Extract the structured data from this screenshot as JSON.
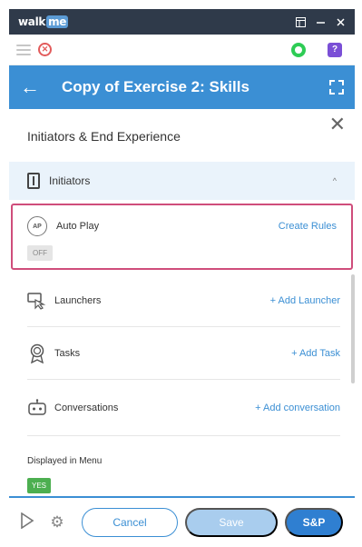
{
  "app": {
    "logo": {
      "walk": "walk",
      "me": "me"
    },
    "titlebar_icons": [
      "window-icon",
      "minimize-icon",
      "close-icon"
    ]
  },
  "header": {
    "title": "Copy of Exercise 2: Skills"
  },
  "panel": {
    "section_title": "Initiators & End Experience",
    "initiators": {
      "label": "Initiators",
      "chevron": "^"
    },
    "auto_play": {
      "icon_text": "AP",
      "label": "Auto Play",
      "link": "Create Rules",
      "state": "OFF"
    },
    "rows": [
      {
        "name": "launchers",
        "label": "Launchers",
        "link": "+ Add Launcher",
        "icon": "launcher-icon"
      },
      {
        "name": "tasks",
        "label": "Tasks",
        "link": "+ Add Task",
        "icon": "task-badge-icon"
      },
      {
        "name": "conversations",
        "label": "Conversations",
        "link": "+ Add conversation",
        "icon": "conversation-icon"
      }
    ],
    "displayed_in_menu": {
      "label": "Displayed in Menu",
      "state": "YES"
    }
  },
  "footer": {
    "cancel": "Cancel",
    "save": "Save",
    "sp": "S&P"
  },
  "colors": {
    "brand_blue": "#3b8fd4",
    "highlight_pink": "#cf4d7b",
    "on_green": "#4caf50"
  }
}
